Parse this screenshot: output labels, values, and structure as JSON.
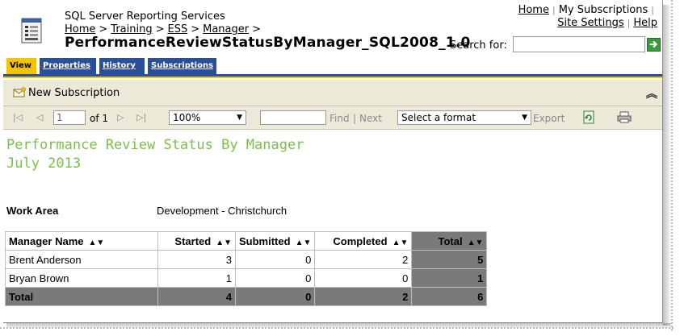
{
  "header": {
    "app_title": "SQL Server Reporting Services",
    "breadcrumbs": [
      "Home",
      "Training",
      "ESS",
      "Manager"
    ],
    "breadcrumb_sep": ">",
    "report_name": "PerformanceReviewStatusByManager_SQL2008_1.0",
    "links": {
      "home": "Home",
      "my_subscriptions": "My Subscriptions",
      "site_settings": "Site Settings",
      "help": "Help"
    },
    "search_label": "Search for:",
    "search_value": ""
  },
  "tabs": [
    {
      "label": "View",
      "active": true
    },
    {
      "label": "Properties",
      "active": false
    },
    {
      "label": "History",
      "active": false
    },
    {
      "label": "Subscriptions",
      "active": false
    }
  ],
  "subscription_bar": {
    "new_subscription": "New Subscription"
  },
  "toolbar": {
    "page_value": "1",
    "of_text": "of 1",
    "zoom": "100%",
    "find_value": "",
    "find": "Find",
    "separator": "|",
    "next": "Next",
    "format": "Select a format",
    "export": "Export"
  },
  "report": {
    "title_line1": "Performance Review Status By Manager",
    "title_line2": "July 2013",
    "work_area_label": "Work Area",
    "work_area_value": "Development - Christchurch",
    "columns": [
      "Manager Name",
      "Started",
      "Submitted",
      "Completed",
      "Total"
    ],
    "rows": [
      [
        "Brent Anderson",
        "3",
        "0",
        "2",
        "5"
      ],
      [
        "Bryan Brown",
        "1",
        "0",
        "0",
        "1"
      ]
    ],
    "total_row": [
      "Total",
      "4",
      "0",
      "2",
      "6"
    ]
  },
  "colors": {
    "title_green": "#7bbf4a",
    "tab_active": "#f3c300",
    "tab_inactive": "#2b4f98",
    "total_fill": "#7a7a7a"
  }
}
